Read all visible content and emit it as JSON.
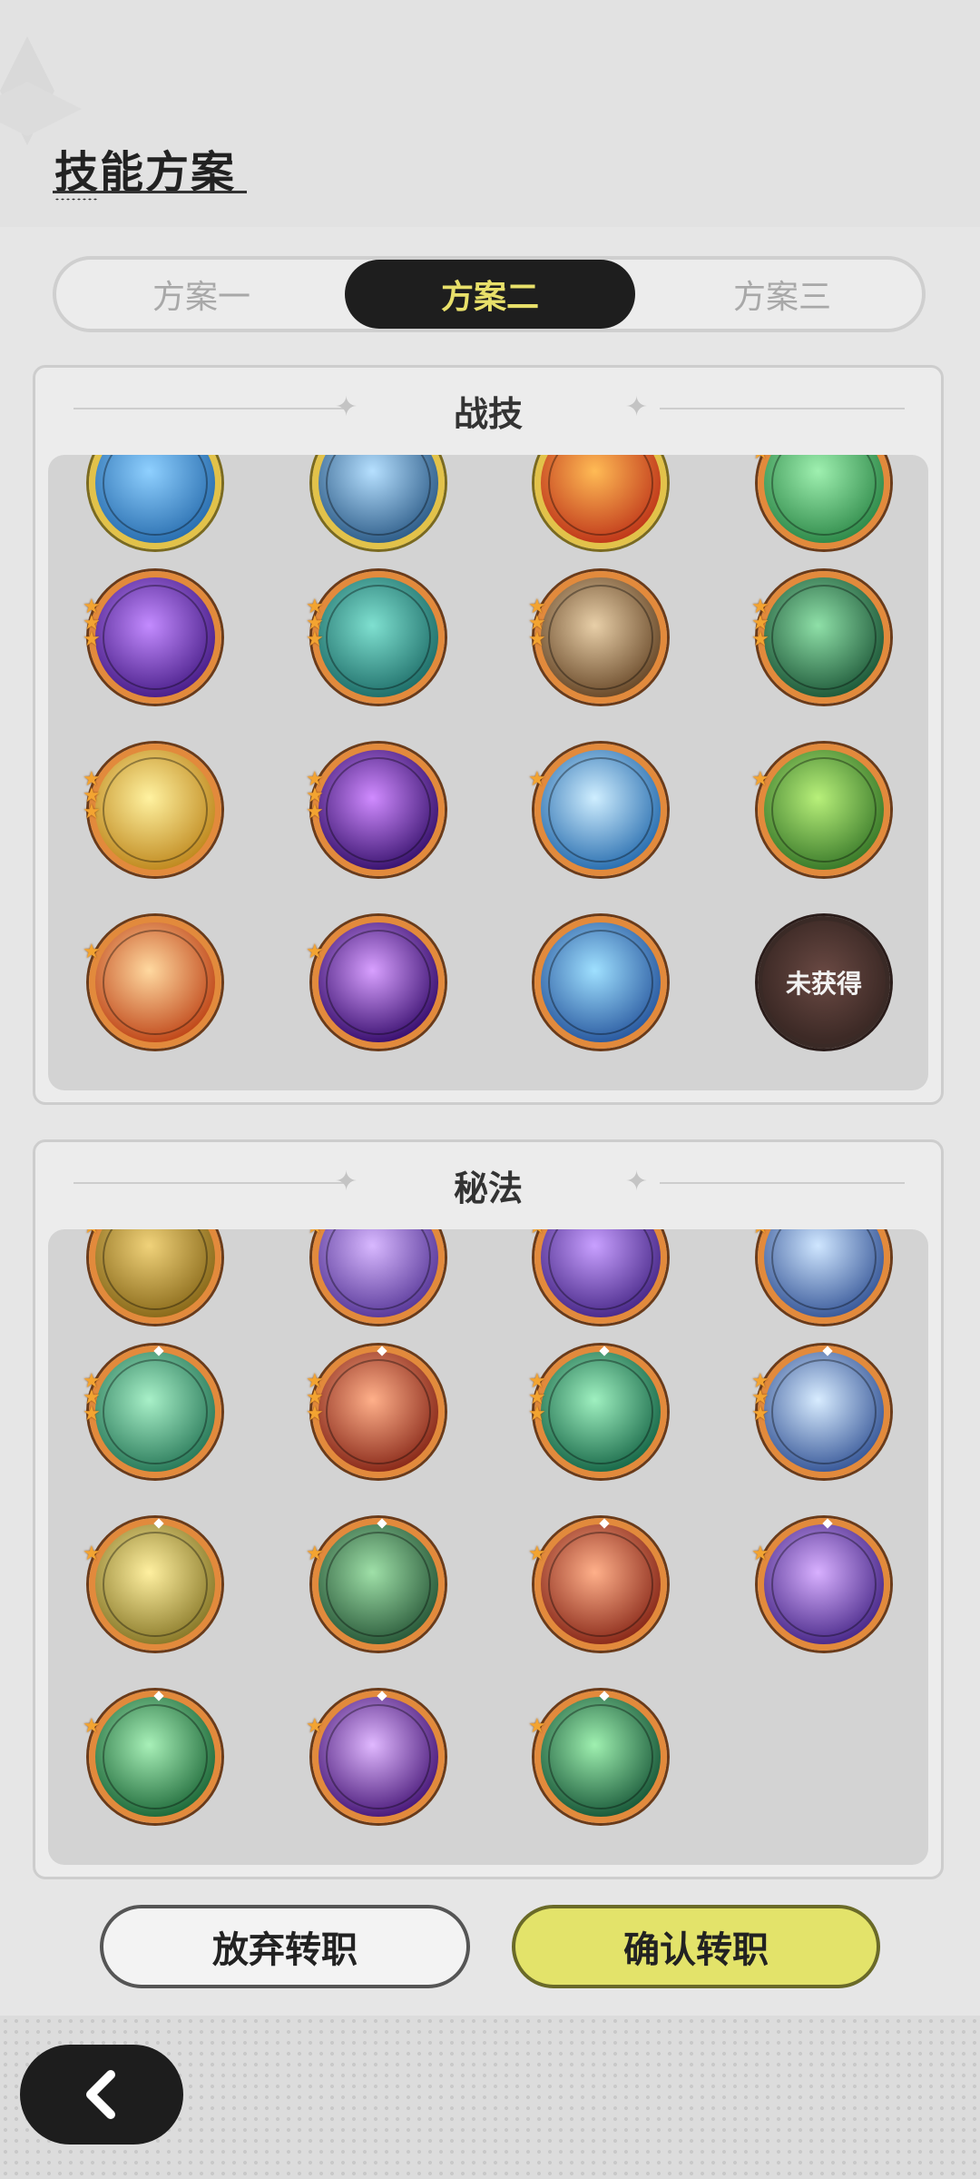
{
  "header": {
    "title": "技能方案"
  },
  "tabs": [
    {
      "label": "方案一",
      "active": false
    },
    {
      "label": "方案二",
      "active": true
    },
    {
      "label": "方案三",
      "active": false
    }
  ],
  "battle_skills": {
    "title": "战技",
    "items": [
      {
        "icon": "blue-lightning-skill-icon",
        "stars": 0,
        "frame": "gold",
        "colors": [
          "#8fd0ff",
          "#2a6fb0"
        ]
      },
      {
        "icon": "ice-shard-skill-icon",
        "stars": 0,
        "frame": "gold",
        "colors": [
          "#b6e0ff",
          "#2f5e8a"
        ]
      },
      {
        "icon": "fire-swirl-skill-icon",
        "stars": 0,
        "frame": "gold",
        "colors": [
          "#ffbb55",
          "#c0381a"
        ]
      },
      {
        "icon": "green-wind-skill-icon",
        "stars": 1,
        "frame": "orange",
        "colors": [
          "#9ff0b0",
          "#2f8a4a"
        ]
      },
      {
        "icon": "purple-vortex-skill-icon",
        "stars": 3,
        "frame": "orange",
        "colors": [
          "#c38bff",
          "#4a1f8a"
        ]
      },
      {
        "icon": "teal-spiral-skill-icon",
        "stars": 3,
        "frame": "orange",
        "colors": [
          "#7fe0d0",
          "#1f6f6a"
        ]
      },
      {
        "icon": "stone-slab-skill-icon",
        "stars": 3,
        "frame": "orange",
        "colors": [
          "#e8cfa8",
          "#6a4a2a"
        ]
      },
      {
        "icon": "thorn-vines-skill-icon",
        "stars": 3,
        "frame": "orange",
        "colors": [
          "#8fe0a8",
          "#1f5a3a"
        ]
      },
      {
        "icon": "holy-cross-skill-icon",
        "stars": 3,
        "frame": "orange",
        "colors": [
          "#fff2a0",
          "#c08a20"
        ]
      },
      {
        "icon": "void-eye-skill-icon",
        "stars": 3,
        "frame": "orange",
        "colors": [
          "#d08bff",
          "#3a1470"
        ]
      },
      {
        "icon": "ice-burst-skill-icon",
        "stars": 1,
        "frame": "orange",
        "colors": [
          "#cfeeff",
          "#2a6fb0"
        ]
      },
      {
        "icon": "treant-skill-icon",
        "stars": 1,
        "frame": "orange",
        "colors": [
          "#b8f07a",
          "#3a7a2a"
        ]
      },
      {
        "icon": "fire-wolf-skill-icon",
        "stars": 1,
        "frame": "orange",
        "colors": [
          "#ffd9a0",
          "#c0481a"
        ]
      },
      {
        "icon": "shadow-hand-skill-icon",
        "stars": 1,
        "frame": "orange",
        "colors": [
          "#d8a0ff",
          "#3a1070"
        ]
      },
      {
        "icon": "water-golem-skill-icon",
        "stars": 0,
        "frame": "orange",
        "colors": [
          "#9fe0ff",
          "#2a5aa0"
        ]
      },
      {
        "icon": "locked-slot-icon",
        "stars": 0,
        "frame": "locked",
        "label": "未获得",
        "colors": [
          "#6b4a44",
          "#3d2a26"
        ]
      }
    ]
  },
  "secret_arts": {
    "title": "秘法",
    "items": [
      {
        "icon": "golden-hand-art-icon",
        "stars": 1,
        "colors": [
          "#f0d27a",
          "#8a6a1a"
        ]
      },
      {
        "icon": "arcane-gear-art-icon",
        "stars": 1,
        "colors": [
          "#d8b8ff",
          "#5a3a9a"
        ]
      },
      {
        "icon": "purple-rune-art-icon",
        "stars": 1,
        "colors": [
          "#c8a0ff",
          "#4a2a8a"
        ]
      },
      {
        "icon": "star-burst-art-icon",
        "stars": 1,
        "colors": [
          "#cfe6ff",
          "#3a5a9a"
        ]
      },
      {
        "icon": "green-cycle-art-icon",
        "stars": 3,
        "colors": [
          "#a8f0c8",
          "#2a7a5a"
        ]
      },
      {
        "icon": "flame-figure-art-icon",
        "stars": 3,
        "colors": [
          "#ffb08a",
          "#8a2a1a"
        ]
      },
      {
        "icon": "emerald-figure-art-icon",
        "stars": 3,
        "colors": [
          "#9ff0c0",
          "#1a6a4a"
        ]
      },
      {
        "icon": "crystal-star-art-icon",
        "stars": 3,
        "colors": [
          "#d8ecff",
          "#3a5a9a"
        ]
      },
      {
        "icon": "golden-arrows-art-icon",
        "stars": 1,
        "colors": [
          "#fff0a0",
          "#8a7a2a"
        ]
      },
      {
        "icon": "green-clock-art-icon",
        "stars": 1,
        "colors": [
          "#9fe0a8",
          "#2a5a3a"
        ]
      },
      {
        "icon": "red-fist-art-icon",
        "stars": 1,
        "colors": [
          "#ffb08a",
          "#8a2a1a"
        ]
      },
      {
        "icon": "purple-ascend-art-icon",
        "stars": 1,
        "colors": [
          "#d8b0ff",
          "#4a2a8a"
        ]
      },
      {
        "icon": "green-shield-art-icon",
        "stars": 1,
        "colors": [
          "#a8f0b8",
          "#1f6a3a"
        ]
      },
      {
        "icon": "heart-witch-art-icon",
        "stars": 1,
        "colors": [
          "#e0b8ff",
          "#4a1a7a"
        ]
      },
      {
        "icon": "green-sparkle-art-icon",
        "stars": 1,
        "colors": [
          "#9ff0b0",
          "#1a5a3a"
        ]
      }
    ]
  },
  "actions": {
    "cancel_label": "放弃转职",
    "confirm_label": "确认转职"
  },
  "nav": {
    "back_icon": "chevron-left-icon"
  }
}
